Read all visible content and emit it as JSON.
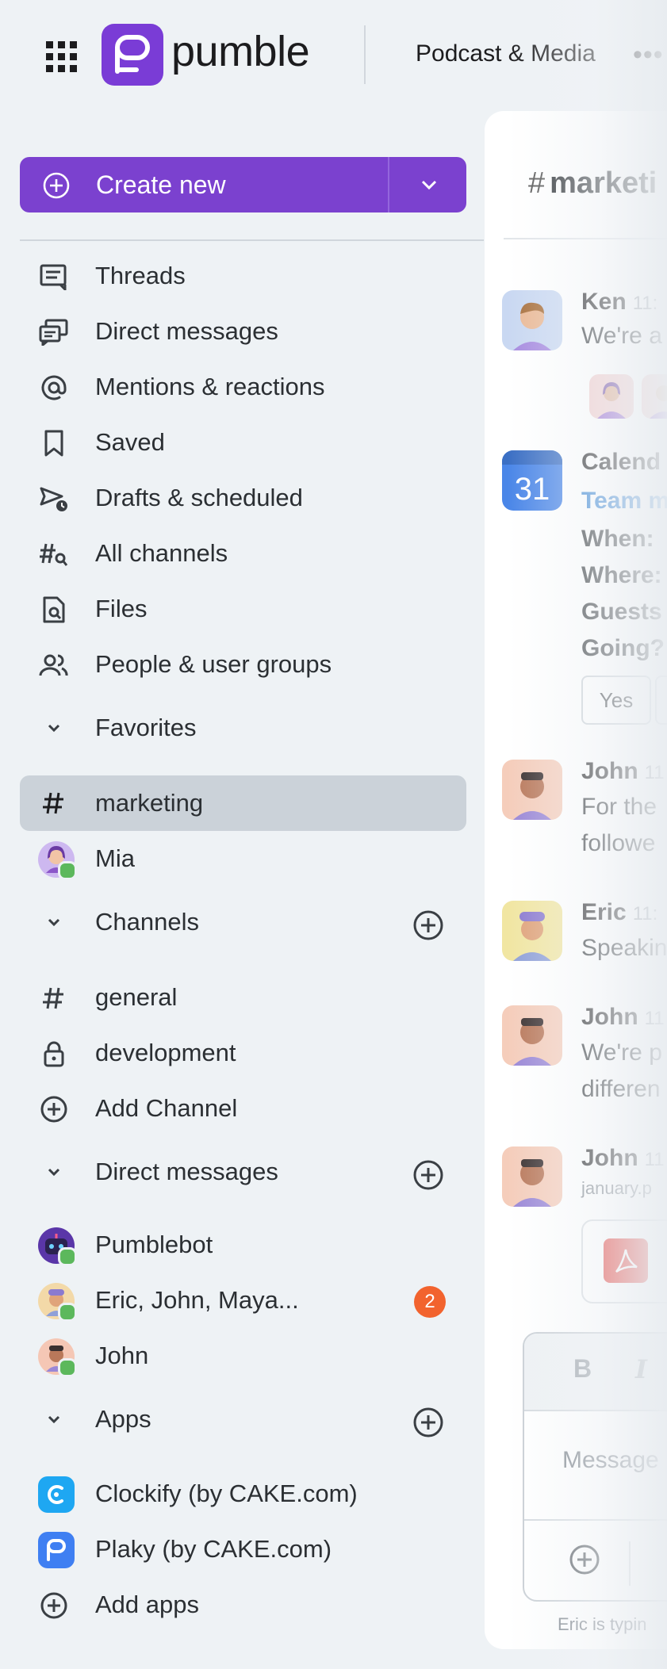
{
  "topbar": {
    "brand": "pumble",
    "workspace": "Podcast & Media",
    "more": "•••"
  },
  "sidebar": {
    "create_new": "Create new",
    "nav": [
      {
        "label": "Threads",
        "icon": "threads-icon"
      },
      {
        "label": "Direct messages",
        "icon": "direct-messages-icon"
      },
      {
        "label": "Mentions & reactions",
        "icon": "at-icon"
      },
      {
        "label": "Saved",
        "icon": "bookmark-icon"
      },
      {
        "label": "Drafts & scheduled",
        "icon": "drafts-icon"
      },
      {
        "label": "All channels",
        "icon": "channel-search-icon"
      },
      {
        "label": "Files",
        "icon": "file-search-icon"
      },
      {
        "label": "People & user groups",
        "icon": "people-icon"
      }
    ],
    "favorites": {
      "label": "Favorites",
      "items": [
        {
          "label": "marketing",
          "type": "channel",
          "active": true
        },
        {
          "label": "Mia",
          "type": "user"
        }
      ]
    },
    "channels": {
      "label": "Channels",
      "items": [
        {
          "label": "general",
          "icon": "hash-icon"
        },
        {
          "label": "development",
          "icon": "lock-icon"
        },
        {
          "label": "Add Channel",
          "icon": "add-circle-icon"
        }
      ]
    },
    "direct_messages": {
      "label": "Direct messages",
      "items": [
        {
          "label": "Pumblebot"
        },
        {
          "label": "Eric, John, Maya...",
          "badge": "2"
        },
        {
          "label": "John"
        }
      ]
    },
    "apps": {
      "label": "Apps",
      "items": [
        {
          "label": "Clockify (by CAKE.com)",
          "color": "#1ea7f2"
        },
        {
          "label": "Plaky (by CAKE.com)",
          "color": "#3f7ff2"
        },
        {
          "label": "Add apps"
        }
      ]
    }
  },
  "pane": {
    "hash": "#",
    "channel_title": "marketi",
    "messages": [
      {
        "name": "Ken",
        "time": "11:",
        "text": "We're a"
      },
      {
        "name": "Calend",
        "calendar_day": "31",
        "link": "Team m",
        "when": "When: ",
        "where": "Where:",
        "guests": "Guests",
        "going": "Going?",
        "yes": "Yes"
      },
      {
        "name": "John",
        "time": "11",
        "line1": "For the",
        "line2": "followe"
      },
      {
        "name": "Eric",
        "time": "11:",
        "text": "Speakin"
      },
      {
        "name": "John",
        "time": "11",
        "line1": "We're p",
        "line2": "differen"
      },
      {
        "name": "John",
        "time": "11",
        "file": "january.p"
      }
    ],
    "composer": {
      "bold": "B",
      "italic": "I",
      "placeholder": "Message"
    },
    "typing": "Eric is typin"
  },
  "colors": {
    "accent": "#7b41cf",
    "active_row": "#cbd2d9",
    "online": "#5cb85c",
    "badge": "#f2632e",
    "link": "#2f7fd1"
  }
}
